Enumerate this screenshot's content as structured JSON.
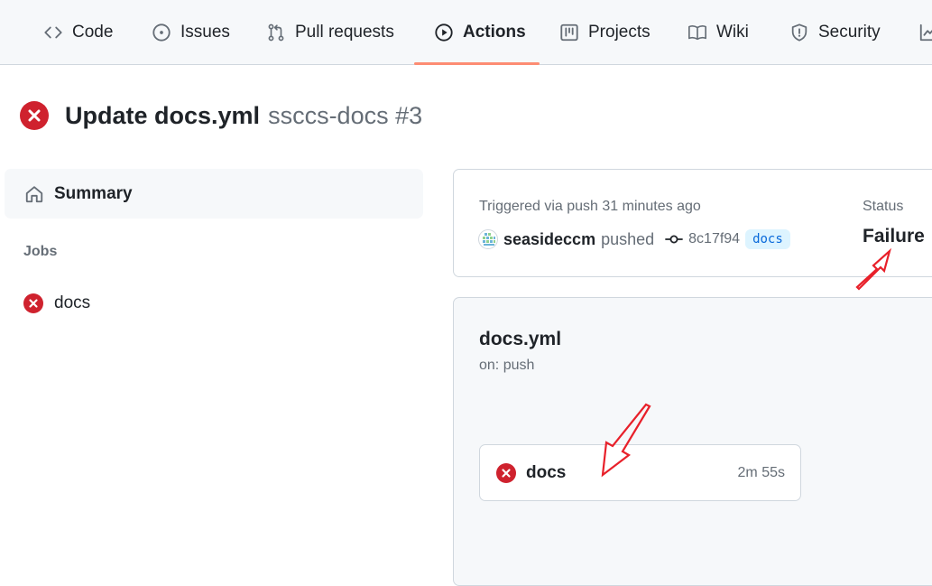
{
  "nav": {
    "tabs": [
      {
        "label": "Code",
        "icon": "code-icon"
      },
      {
        "label": "Issues",
        "icon": "issue-icon"
      },
      {
        "label": "Pull requests",
        "icon": "pull-request-icon"
      },
      {
        "label": "Actions",
        "icon": "play-icon",
        "active": true
      },
      {
        "label": "Projects",
        "icon": "project-icon"
      },
      {
        "label": "Wiki",
        "icon": "book-icon"
      },
      {
        "label": "Security",
        "icon": "shield-icon"
      }
    ]
  },
  "run": {
    "title": "Update docs.yml",
    "workflow_and_number": "ssccs-docs #3",
    "status_icon": "x-circle-fill-icon"
  },
  "sidebar": {
    "summary_label": "Summary",
    "jobs_heading": "Jobs",
    "jobs": [
      {
        "label": "docs",
        "status": "failure"
      }
    ]
  },
  "trigger": {
    "text": "Triggered via push 31 minutes ago",
    "actor": "seasideccm",
    "action": "pushed",
    "commit_sha": "8c17f94",
    "branch": "docs",
    "status_label": "Status",
    "status_value": "Failure"
  },
  "workflow": {
    "file": "docs.yml",
    "trigger": "on: push",
    "job": {
      "name": "docs",
      "duration": "2m 55s"
    }
  },
  "colors": {
    "failure": "#cf222e",
    "annotation": "#e8202a",
    "active_tab": "#fd8c73"
  }
}
